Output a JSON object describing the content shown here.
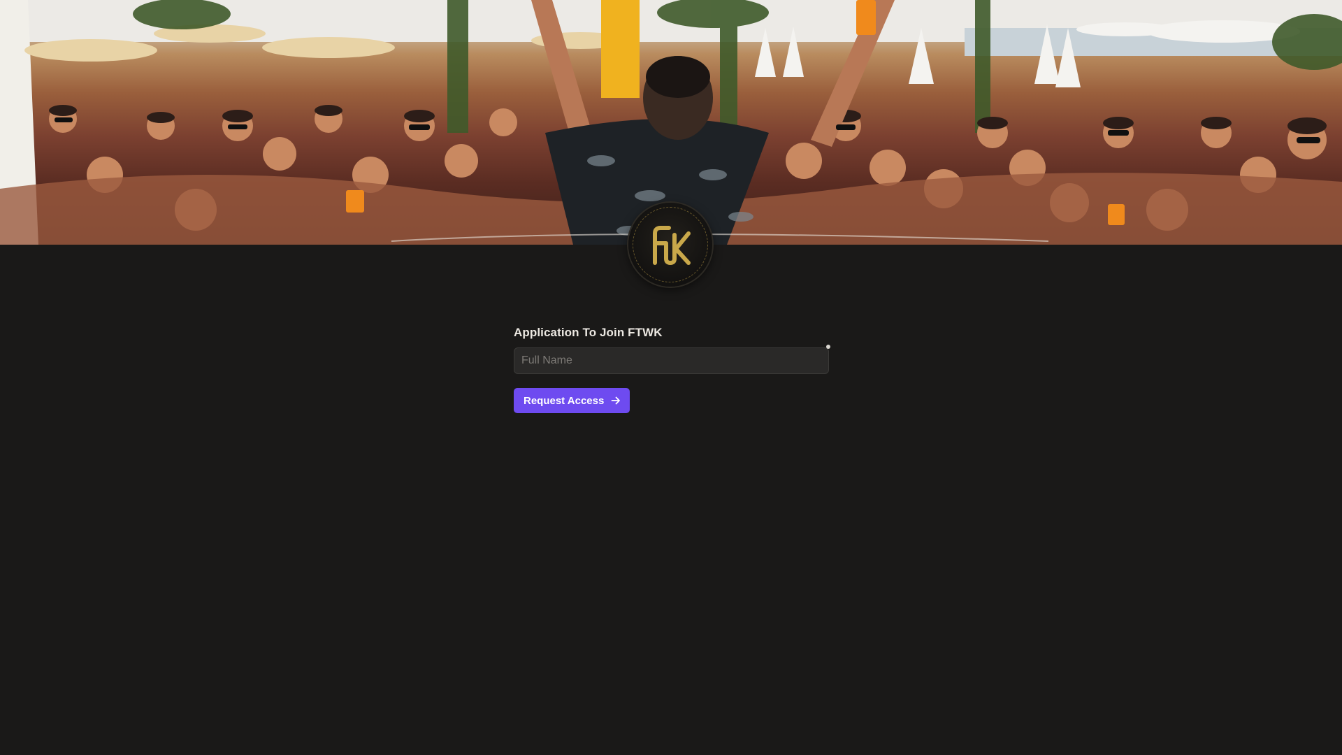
{
  "hero": {
    "image": "crowd-party-photo"
  },
  "logo": {
    "text": "FTWK",
    "icon": "ftwk-logo-icon",
    "accent_color": "#c9a84a"
  },
  "form": {
    "title": "Application To Join FTWK",
    "full_name": {
      "placeholder": "Full Name",
      "value": "",
      "required": true
    },
    "submit_label": "Request Access",
    "submit_icon": "arrow-right-icon"
  },
  "colors": {
    "background": "#1a1918",
    "button": "#6e4bf0",
    "input_bg": "#2a2928"
  }
}
